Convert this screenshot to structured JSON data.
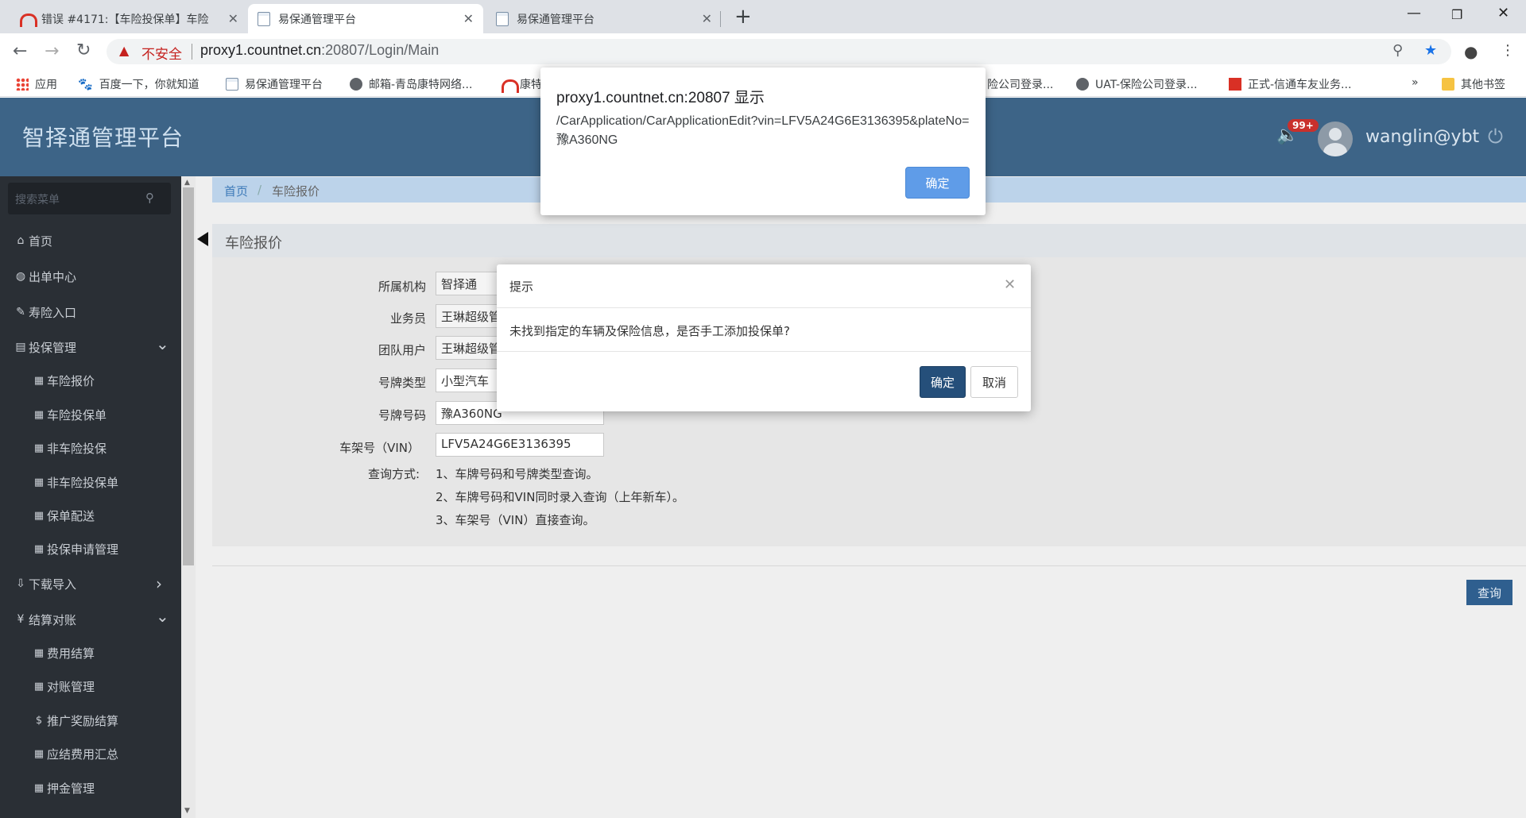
{
  "browser": {
    "tabs": [
      {
        "title": "错误 #4171:【车险投保单】车险"
      },
      {
        "title": "易保通管理平台"
      },
      {
        "title": "易保通管理平台"
      }
    ],
    "new_tab": "+",
    "omnibox": {
      "insecure_label": "不安全",
      "url_host": "proxy1.countnet.cn",
      "url_rest": ":20807/Login/Main"
    },
    "bookmarks": [
      {
        "label": "应用",
        "icon": "apps-grid-icon"
      },
      {
        "label": "百度一下，你就知道",
        "icon": "baidu-paw-icon"
      },
      {
        "label": "易保通管理平台",
        "icon": "doc-icon"
      },
      {
        "label": "邮箱-青岛康特网络...",
        "icon": "globe-icon"
      },
      {
        "label": "康特",
        "icon": "redmine-icon"
      },
      {
        "label": "险公司登录...",
        "icon": ""
      },
      {
        "label": "UAT-保险公司登录...",
        "icon": "globe-icon"
      },
      {
        "label": "正式-信通车友业务...",
        "icon": "red-x-icon"
      },
      {
        "label": "»",
        "icon": ""
      },
      {
        "label": "其他书签",
        "icon": "folder-icon"
      }
    ]
  },
  "header": {
    "title": "智择通管理平台",
    "badge": "99+",
    "username": "wanglin@ybt"
  },
  "sidebar": {
    "search_placeholder": "搜索菜单",
    "items": [
      {
        "label": "首页",
        "icon": "home-icon",
        "level": 1
      },
      {
        "label": "出单中心",
        "icon": "globe-icon",
        "level": 1
      },
      {
        "label": "寿险入口",
        "icon": "leaf-icon",
        "level": 1
      },
      {
        "label": "投保管理",
        "icon": "file-icon",
        "level": 1,
        "chevron": "down"
      },
      {
        "label": "车险报价",
        "icon": "grid-icon",
        "level": 2
      },
      {
        "label": "车险投保单",
        "icon": "grid-icon",
        "level": 2
      },
      {
        "label": "非车险投保",
        "icon": "grid-icon",
        "level": 2
      },
      {
        "label": "非车险投保单",
        "icon": "grid-icon",
        "level": 2
      },
      {
        "label": "保单配送",
        "icon": "grid-icon",
        "level": 2
      },
      {
        "label": "投保申请管理",
        "icon": "grid-icon",
        "level": 2
      },
      {
        "label": "下载导入",
        "icon": "download-icon",
        "level": 1,
        "chevron": "right"
      },
      {
        "label": "结算对账",
        "icon": "yen-icon",
        "level": 1,
        "chevron": "down"
      },
      {
        "label": "费用结算",
        "icon": "grid-icon",
        "level": 2
      },
      {
        "label": "对账管理",
        "icon": "grid-icon",
        "level": 2
      },
      {
        "label": "推广奖励结算",
        "icon": "dollar-icon",
        "level": 2
      },
      {
        "label": "应结费用汇总",
        "icon": "grid-icon",
        "level": 2
      },
      {
        "label": "押金管理",
        "icon": "grid-icon",
        "level": 2
      }
    ]
  },
  "breadcrumb": {
    "home": "首页",
    "sep": "/",
    "current": "车险报价"
  },
  "panel": {
    "title": "车险报价"
  },
  "form": {
    "org_label": "所属机构",
    "org_value": "智择通",
    "salesman_label": "业务员",
    "salesman_value": "王琳超级管",
    "team_label": "团队用户",
    "team_value": "王琳超级管",
    "plate_type_label": "号牌类型",
    "plate_type_value": "小型汽车",
    "plate_no_label": "号牌号码",
    "plate_no_value": "豫A360NG",
    "vin_label": "车架号（VIN）",
    "vin_value": "LFV5A24G6E3136395",
    "query_method_label": "查询方式:",
    "query_notes": [
      "1、车牌号码和号牌类型查询。",
      "2、车牌号码和VIN同时录入查询（上年新车）。",
      "3、车架号（VIN）直接查询。"
    ],
    "query_button": "查询"
  },
  "alert": {
    "origin": "proxy1.countnet.cn:20807 显示",
    "message": "/CarApplication/CarApplicationEdit?vin=LFV5A24G6E3136395&plateNo=豫A360NG",
    "ok": "确定"
  },
  "modal": {
    "title": "提示",
    "body": "未找到指定的车辆及保险信息，是否手工添加投保单?",
    "ok": "确定",
    "cancel": "取消"
  }
}
